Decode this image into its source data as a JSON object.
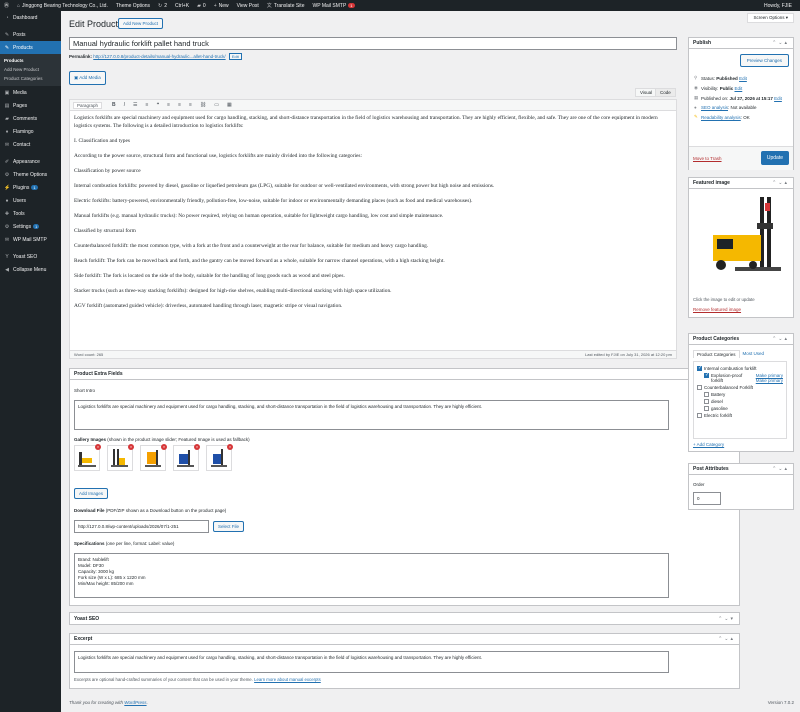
{
  "adminbar": {
    "site": "Jinggong Bearing Technology Co., Ltd.",
    "theme_options": "Theme Options",
    "updates": "2",
    "shortcut": "Ctrl+K",
    "comments": "0",
    "new": "New",
    "view_post": "View Post",
    "translate": "Translate Site",
    "smtp": "WP Mail SMTP",
    "smtp_badge": "1",
    "howdy": "Howdy, FJIE"
  },
  "sidebar": {
    "dashboard": "Dashboard",
    "posts": "Posts",
    "products": "Products",
    "sub_products": "Products",
    "sub_add_new": "Add New Product",
    "sub_categories": "Product Categories",
    "media": "Media",
    "pages": "Pages",
    "comments": "Comments",
    "flamingo": "Flamingo",
    "contact": "Contact",
    "appearance": "Appearance",
    "theme_options": "Theme Options",
    "plugins": "Plugins",
    "plugins_badge": "1",
    "users": "Users",
    "tools": "Tools",
    "settings": "Settings",
    "settings_badge": "1",
    "wp_mail": "WP Mail SMTP",
    "yoast": "Yoast SEO",
    "collapse": "Collapse Menu"
  },
  "header": {
    "title": "Edit Product",
    "add_new": "Add New Product",
    "screen_options": "Screen Options ▾"
  },
  "post": {
    "title": "Manual hydraulic forklift pallet hand truck",
    "permalink_label": "Permalink:",
    "permalink_url": "http://127.0.0.8/product-details/manual-hydraulic...allet-hand-truck/",
    "permalink_edit": "Edit",
    "add_media": "Add Media",
    "tab_visual": "Visual",
    "tab_code": "Code",
    "format": "Paragraph"
  },
  "content": [
    "Logistics forklifts are special machinery and equipment used for cargo handling, stacking, and short-distance transportation in the field of logistics warehousing and transportation. They are highly efficient, flexible, and safe. They are one of the core equipment in modern logistics systems. The following is a detailed introduction to logistics forklifts:",
    "I. Classification and types",
    "According to the power source, structural form and functional use, logistics forklifts are mainly divided into the following categories:",
    "Classification by power source",
    "Internal combustion forklifts: powered by diesel, gasoline or liquefied petroleum gas (LPG), suitable for outdoor or well-ventilated environments, with strong power but high noise and emissions.",
    "Electric forklifts: battery-powered, environmentally friendly, pollution-free, low-noise, suitable for indoor or environmentally demanding places (such as food and medical warehouses).",
    "Manual forklifts (e.g. manual hydraulic trucks): No power required, relying on human operation, suitable for lightweight cargo handling, low cost and simple maintenance.",
    "Classified by structural form",
    "Counterbalanced forklift: the most common type, with a fork at the front and a counterweight at the rear for balance, suitable for medium and heavy cargo handling.",
    "Reach forklift: The fork can be moved back and forth, and the gantry can be moved forward as a whole, suitable for narrow channel operations, with a high stacking height.",
    "Side forklift: The fork is located on the side of the body, suitable for the handling of long goods such as wood and steel pipes.",
    "Stacker trucks (such as three-way stacking forklifts): designed for high-rise shelves, enabling multi-directional stacking with high space utilization.",
    "AGV forklift (automated guided vehicle): driverless, automated handling through laser, magnetic stripe or visual navigation."
  ],
  "editor_footer": {
    "word_count": "Word count: 265",
    "last_edited": "Last edited by FJIE on July 31, 2026 at 12:20 pm"
  },
  "extra": {
    "title": "Product Extra Fields",
    "short_intro_label": "Short Intro",
    "short_intro": "Logistics forklifts are special machinery and equipment used for cargo handling, stacking, and short-distance transportation in the field of logistics warehousing and transportation. They are highly efficient.",
    "gallery_label": "Gallery Images",
    "gallery_note": "(shown in the product image slider; Featured Image is used as fallback)",
    "add_images": "Add Images",
    "download_label": "Download File",
    "download_note": "(PDF/ZIP shown as a Download button on the product page)",
    "download_value": "http://127.0.0.8/wp-content/uploads/2026/07/1-251",
    "select_file": "Select File",
    "specs_label": "Specifications",
    "specs_note": "(one per line, format: Label: value)",
    "specs": [
      "Brand: Noblelift",
      "Model: DF30",
      "Capacity: 3000 kg",
      "Fork size (W x L): 685 x 1220 mm",
      "Min/Max height: 85/200 mm"
    ]
  },
  "yoast": {
    "title": "Yoast SEO"
  },
  "excerpt": {
    "title": "Excerpt",
    "text": "Logistics forklifts are special machinery and equipment used for cargo handling, stacking, and short-distance transportation in the field of logistics warehousing and transportation. They are highly efficient.",
    "note": "Excerpts are optional hand-crafted summaries of your content that can be used in your theme.",
    "learn_more": "Learn more about manual excerpts"
  },
  "publish": {
    "title": "Publish",
    "preview": "Preview Changes",
    "status_label": "Status:",
    "status": "Published",
    "visibility_label": "Visibility:",
    "visibility": "Public",
    "published_label": "Published on:",
    "published": "Jul 27, 2026 at 15:17",
    "edit": "Edit",
    "seo_label": "SEO analysis",
    "seo_value": ": Not available",
    "readability_label": "Readability analysis",
    "readability_value": ": OK",
    "trash": "Move to Trash",
    "update": "Update"
  },
  "featured": {
    "title": "Featured image",
    "hint": "Click the image to edit or update",
    "remove": "Remove featured image"
  },
  "categories": {
    "title": "Product Categories",
    "tab_all": "Product Categories",
    "tab_used": "Most Used",
    "items": [
      {
        "name": "Internal combustion forklift",
        "checked": true,
        "level": 0
      },
      {
        "name": "Explosion-proof forklift",
        "checked": true,
        "level": 1
      },
      {
        "name": "Counterbalanced Forklift",
        "checked": false,
        "level": 0
      },
      {
        "name": "Battery",
        "checked": false,
        "level": 1
      },
      {
        "name": "diesel",
        "checked": false,
        "level": 1
      },
      {
        "name": "gasoline",
        "checked": false,
        "level": 1
      },
      {
        "name": "Electric forklift",
        "checked": false,
        "level": 0
      }
    ],
    "make_primary": "Make primary",
    "add_new": "+ Add Category"
  },
  "attributes": {
    "title": "Post Attributes",
    "order_label": "Order",
    "order_value": "0"
  },
  "footer": {
    "thanks": "Thank you for creating with",
    "wordpress": "WordPress",
    "version": "Version 7.0.2"
  },
  "colors": {
    "accent": "#2271b1",
    "admin_dark": "#1d2327",
    "danger": "#d63638",
    "forklift_yellow": "#f5b800"
  }
}
